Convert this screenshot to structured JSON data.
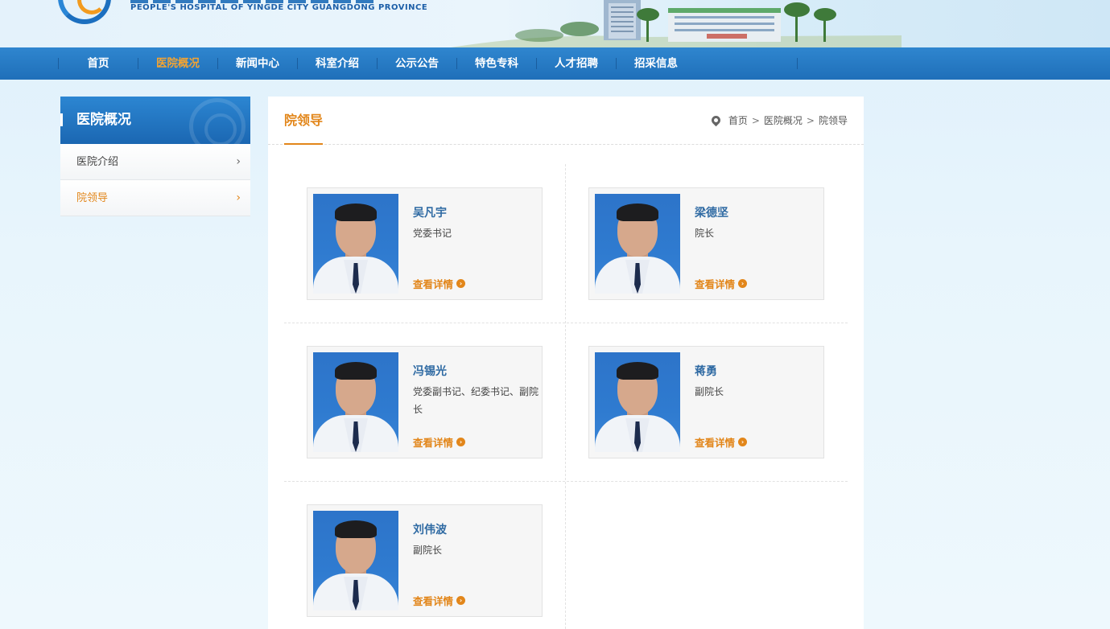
{
  "header": {
    "logo_en": "PEOPLE'S HOSPITAL OF YINGDE CITY GUANGDONG PROVINCE"
  },
  "nav": {
    "items": [
      {
        "label": "首页"
      },
      {
        "label": "医院概况",
        "active": true
      },
      {
        "label": "新闻中心"
      },
      {
        "label": "科室介绍"
      },
      {
        "label": "公示公告"
      },
      {
        "label": "特色专科"
      },
      {
        "label": "人才招聘"
      },
      {
        "label": "招采信息"
      }
    ]
  },
  "sidebar": {
    "title": "医院概况",
    "items": [
      {
        "label": "医院介绍",
        "active": false
      },
      {
        "label": "院领导",
        "active": true
      }
    ]
  },
  "main": {
    "title": "院领导",
    "breadcrumb": [
      "首页",
      "医院概况",
      "院领导"
    ],
    "detail_label": "查看详情",
    "leaders": [
      {
        "name": "吴凡宇",
        "role": "党委书记"
      },
      {
        "name": "梁德坚",
        "role": "院长"
      },
      {
        "name": "冯锡光",
        "role": "党委副书记、纪委书记、副院长"
      },
      {
        "name": "蒋勇",
        "role": "副院长"
      },
      {
        "name": "刘伟波",
        "role": "副院长"
      }
    ]
  },
  "colors": {
    "nav_blue": "#1f6fb9",
    "accent_orange": "#e2861a",
    "name_blue": "#2f6aa3"
  }
}
